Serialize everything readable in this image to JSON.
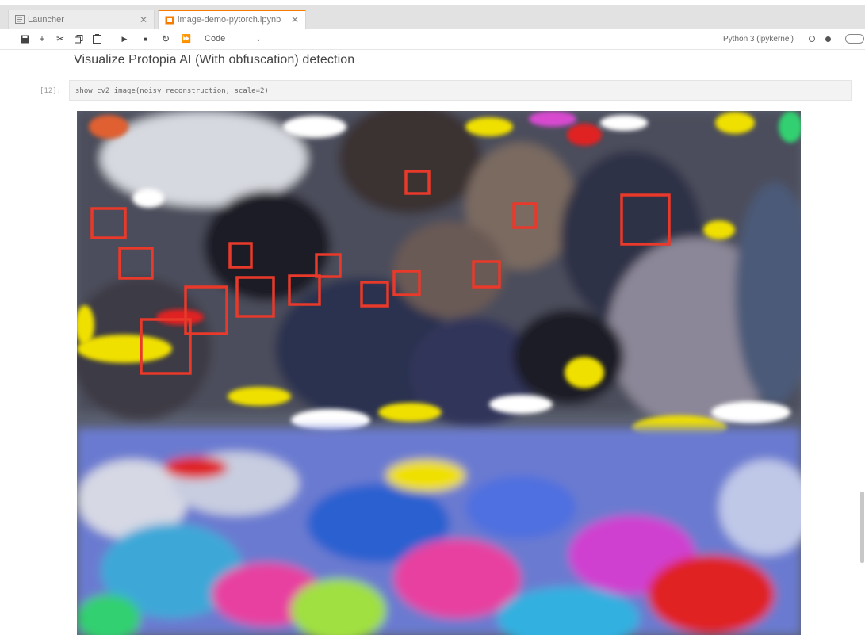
{
  "tabs": [
    {
      "label": "Launcher",
      "icon": "launcher-icon",
      "active": false
    },
    {
      "label": "image-demo-pytorch.ipynb",
      "icon": "notebook-icon",
      "active": true
    }
  ],
  "toolbar": {
    "icons": [
      "save-icon",
      "add-cell-icon",
      "cut-icon",
      "copy-icon",
      "paste-icon",
      "run-icon",
      "stop-icon",
      "restart-icon",
      "run-all-icon"
    ],
    "cell_type": "Code",
    "kernel_name": "Python 3 (ipykernel)"
  },
  "notebook": {
    "heading": "Visualize Protopia AI (With obfuscation) detection",
    "cell_prompt": "[12]:",
    "cell_code": "show_cv2_image(noisy_reconstruction, scale=2)"
  },
  "output": {
    "detections_count": 15,
    "box_color": "#e8392a"
  },
  "colors": {
    "accent": "#f57c00",
    "tabbar_bg": "#e2e2e2",
    "cell_bg": "#f3f3f3"
  }
}
